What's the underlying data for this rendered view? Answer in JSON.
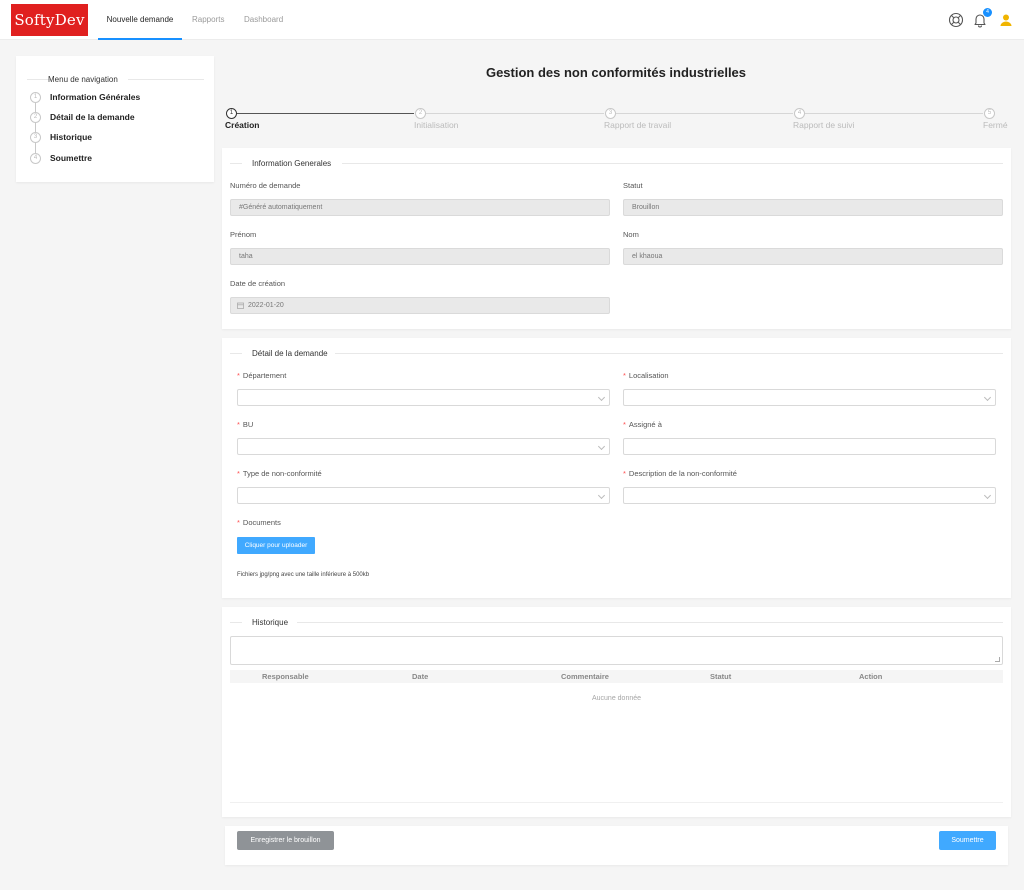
{
  "header": {
    "logo_text": "SoftyDev",
    "nav": [
      "Nouvelle demande",
      "Rapports",
      "Dashboard"
    ],
    "active_nav": "Nouvelle demande",
    "notification_count": "4",
    "icons": [
      "help-icon",
      "bell-icon",
      "user-icon"
    ]
  },
  "sidebar": {
    "title": "Menu de navigation",
    "items": [
      {
        "num": "1",
        "label": "Information Générales"
      },
      {
        "num": "2",
        "label": "Détail de la demande"
      },
      {
        "num": "3",
        "label": "Historique"
      },
      {
        "num": "4",
        "label": "Soumettre"
      }
    ]
  },
  "page_title": "Gestion des non conformités industrielles",
  "steps": [
    {
      "num": "1",
      "label": "Création",
      "active": true
    },
    {
      "num": "2",
      "label": "Initialisation",
      "active": false
    },
    {
      "num": "3",
      "label": "Rapport de travail",
      "active": false
    },
    {
      "num": "4",
      "label": "Rapport de suivi",
      "active": false
    },
    {
      "num": "5",
      "label": "Fermé",
      "active": false
    }
  ],
  "info": {
    "title": "Information Generales",
    "numero_label": "Numéro de demande",
    "numero_value": "#Généré automatiquement",
    "statut_label": "Statut",
    "statut_value": "Brouillon",
    "prenom_label": "Prénom",
    "prenom_value": "taha",
    "nom_label": "Nom",
    "nom_value": "el khaoua",
    "date_label": "Date de création",
    "date_value": "2022-01-20"
  },
  "detail": {
    "title": "Détail de la demande",
    "departement_label": "Département",
    "localisation_label": "Localisation",
    "bu_label": "BU",
    "assigne_label": "Assigné à",
    "type_label": "Type de non-conformité",
    "description_label": "Description de la non-conformité",
    "documents_label": "Documents",
    "upload_label": "Cliquer pour uploader",
    "upload_hint": "Fichiers jpg/png avec une taille inférieure à 500kb",
    "required_mark": "*"
  },
  "historique": {
    "title": "Historique",
    "columns": [
      "Responsable",
      "Date",
      "Commentaire",
      "Statut",
      "Action"
    ],
    "empty_text": "Aucune donnée"
  },
  "footer": {
    "draft_label": "Enregistrer le brouillon",
    "submit_label": "Soumettre"
  },
  "colors": {
    "brand": "#e0201f",
    "primary": "#1890ff",
    "button_blue": "#40a9ff",
    "draft_gray": "#8f9397",
    "required": "#ff4d4f",
    "user_icon": "#f0b400"
  }
}
